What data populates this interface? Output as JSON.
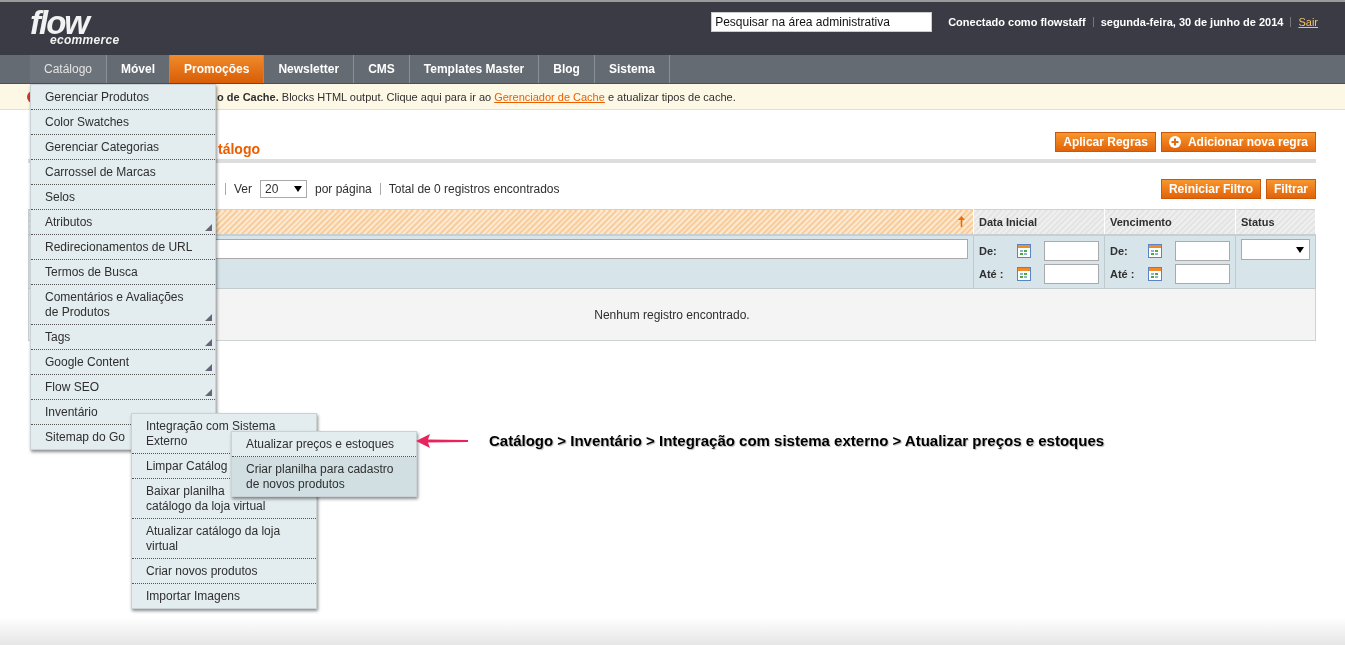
{
  "header": {
    "logo": {
      "word": "flow",
      "tagline": "ecommerce"
    },
    "search": {
      "placeholder": "Pesquisar na área administrativa"
    },
    "user": "Conectado como flowstaff",
    "date": "segunda-feira, 30 de junho de 2014",
    "logout": "Sair"
  },
  "nav": [
    {
      "label": "Catálogo",
      "selected": false,
      "open": true
    },
    {
      "label": "Móvel",
      "selected": false,
      "open": false
    },
    {
      "label": "Promoções",
      "selected": true,
      "open": false
    },
    {
      "label": "Newsletter",
      "selected": false,
      "open": false
    },
    {
      "label": "CMS",
      "selected": false,
      "open": false
    },
    {
      "label": "Templates Master",
      "selected": false,
      "open": false
    },
    {
      "label": "Blog",
      "selected": false,
      "open": false
    },
    {
      "label": "Sistema",
      "selected": false,
      "open": false
    }
  ],
  "notice": {
    "bold": "o de Cache.",
    "text": "Blocks HTML output. Clique aqui para ir ao",
    "link": "Gerenciador de Cache",
    "after": "e atualizar tipos de cache."
  },
  "page_title": "tálogo",
  "actions": [
    {
      "label": "Aplicar Regras",
      "kind": "plain"
    },
    {
      "label": "Adicionar nova regra",
      "kind": "add"
    }
  ],
  "pager": {
    "view": "Ver",
    "per_page": "20",
    "suffix": "por página",
    "total": "Total de 0 registros encontrados"
  },
  "filter_buttons": [
    "Reiniciar Filtro",
    "Filtrar"
  ],
  "grid": {
    "columns": [
      {
        "kind": "text",
        "sorted": true
      },
      {
        "kind": "date",
        "label": "Data Inicial",
        "sorted": false,
        "from_label": "De:",
        "to_label": "Até :"
      },
      {
        "kind": "date",
        "label": "Vencimento",
        "sorted": false,
        "from_label": "De:",
        "to_label": "Até :"
      },
      {
        "kind": "select",
        "label": "Status",
        "sorted": false
      }
    ],
    "empty_message": "Nenhum registro encontrado."
  },
  "menus": [
    {
      "items": [
        {
          "lines": [
            "Gerenciar Produtos"
          ],
          "has_submenu": false,
          "highlighted": false
        },
        {
          "lines": [
            "Color Swatches"
          ],
          "has_submenu": false,
          "highlighted": false
        },
        {
          "lines": [
            "Gerenciar Categorias"
          ],
          "has_submenu": false,
          "highlighted": false
        },
        {
          "lines": [
            "Carrossel de Marcas"
          ],
          "has_submenu": false,
          "highlighted": false
        },
        {
          "lines": [
            "Selos"
          ],
          "has_submenu": false,
          "highlighted": false
        },
        {
          "lines": [
            "Atributos"
          ],
          "has_submenu": true,
          "highlighted": false
        },
        {
          "lines": [
            "Redirecionamentos de URL"
          ],
          "has_submenu": false,
          "highlighted": false
        },
        {
          "lines": [
            "Termos de Busca"
          ],
          "has_submenu": false,
          "highlighted": false
        },
        {
          "lines": [
            "Comentários e Avaliações",
            "de Produtos"
          ],
          "has_submenu": true,
          "highlighted": false
        },
        {
          "lines": [
            "Tags"
          ],
          "has_submenu": true,
          "highlighted": false
        },
        {
          "lines": [
            "Google Content"
          ],
          "has_submenu": true,
          "highlighted": false
        },
        {
          "lines": [
            "Flow SEO"
          ],
          "has_submenu": true,
          "highlighted": false
        },
        {
          "lines": [
            "Inventário"
          ],
          "highlighted": false
        },
        {
          "lines": [
            "Sitemap do Go"
          ],
          "highlighted": false
        }
      ]
    },
    {
      "items": [
        {
          "lines": [
            "Integração com Sistema",
            "Externo"
          ],
          "highlighted": false
        },
        {
          "lines": [
            "Limpar Catálog"
          ],
          "highlighted": false
        },
        {
          "lines": [
            "Baixar planilha",
            "catálogo da loja virtual"
          ],
          "highlighted": false
        },
        {
          "lines": [
            "Atualizar catálogo da loja",
            "virtual"
          ],
          "highlighted": false
        },
        {
          "lines": [
            "Criar novos produtos"
          ],
          "highlighted": false
        },
        {
          "lines": [
            "Importar Imagens"
          ],
          "highlighted": false
        }
      ]
    },
    {
      "items": [
        {
          "lines": [
            "Atualizar preços e estoques"
          ],
          "highlighted": false
        },
        {
          "lines": [
            "Criar planilha para cadastro",
            "de novos produtos"
          ],
          "highlighted": true
        }
      ]
    }
  ],
  "annotation": "Catálogo > Inventário > Integração com sistema externo > Atualizar preços e estoques"
}
